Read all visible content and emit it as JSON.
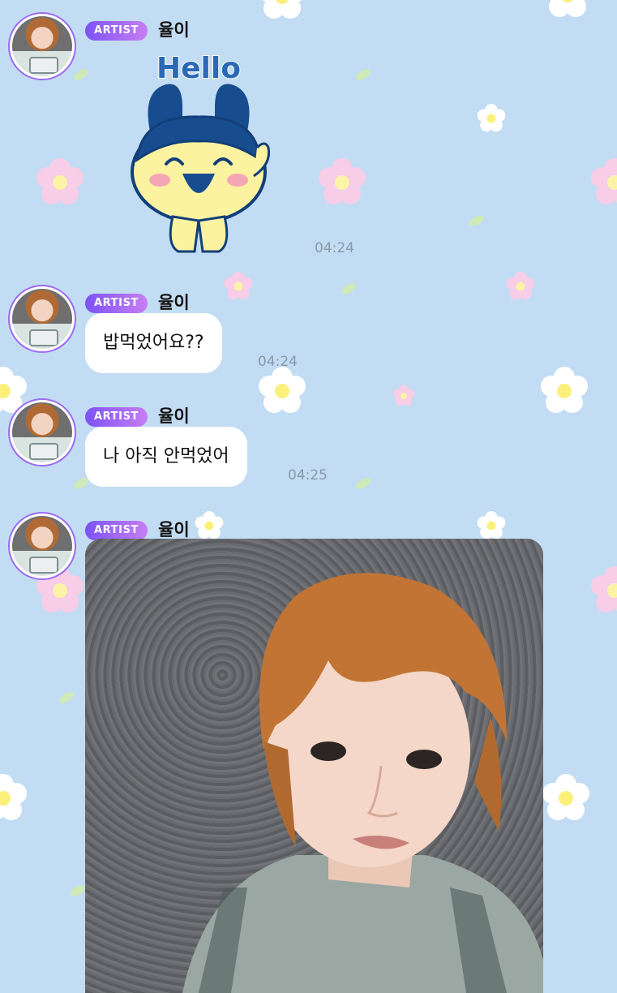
{
  "chat": {
    "messages": [
      {
        "badge": "ARTIST",
        "sender": "율이",
        "sticker_text": "Hello",
        "time": "04:24"
      },
      {
        "badge": "ARTIST",
        "sender": "율이",
        "text": "밥먹었어요??",
        "time": "04:24"
      },
      {
        "badge": "ARTIST",
        "sender": "율이",
        "text": "나 아직 안먹었어",
        "time": "04:25"
      },
      {
        "badge": "ARTIST",
        "sender": "율이",
        "image": "selfie-photo"
      }
    ]
  },
  "colors": {
    "background": "#c2dcf3",
    "badge_start": "#7c52f5",
    "badge_end": "#c77ef4",
    "bubble": "#ffffff",
    "time": "#8a99a8"
  }
}
